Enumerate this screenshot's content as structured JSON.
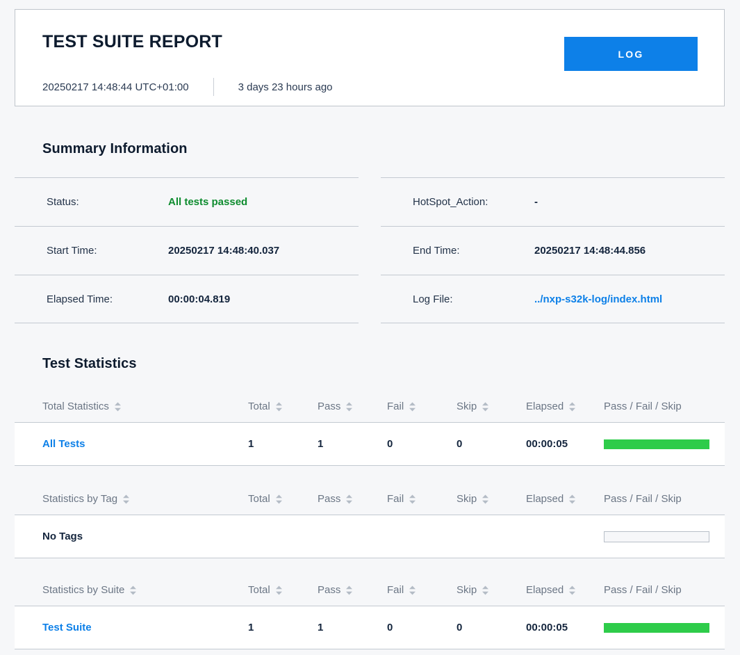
{
  "header": {
    "title": "TEST SUITE REPORT",
    "generated": "20250217 14:48:44 UTC+01:00",
    "relative_time": "3 days 23 hours ago",
    "log_button": "LOG",
    "accent_color": "#0d80e8"
  },
  "summary": {
    "title": "Summary Information",
    "left": [
      {
        "label": "Status:",
        "value": "All tests passed",
        "kind": "pass"
      },
      {
        "label": "Start Time:",
        "value": "20250217 14:48:40.037",
        "kind": "text"
      },
      {
        "label": "Elapsed Time:",
        "value": "00:00:04.819",
        "kind": "text"
      }
    ],
    "right": [
      {
        "label": "HotSpot_Action:",
        "value": "-",
        "kind": "dash"
      },
      {
        "label": "End Time:",
        "value": "20250217 14:48:44.856",
        "kind": "text"
      },
      {
        "label": "Log File:",
        "value": "../nxp-s32k-log/index.html",
        "kind": "link"
      }
    ]
  },
  "statistics": {
    "title": "Test Statistics",
    "columns": {
      "total": "Total",
      "pass": "Pass",
      "fail": "Fail",
      "skip": "Skip",
      "elapsed": "Elapsed",
      "graph": "Pass / Fail / Skip"
    },
    "tables": [
      {
        "header": "Total Statistics",
        "rows": [
          {
            "name": "All Tests",
            "name_is_link": true,
            "total": "1",
            "pass": "1",
            "fail": "0",
            "skip": "0",
            "elapsed": "00:00:05",
            "bar": {
              "pass_pct": 100,
              "fail_pct": 0,
              "skip_pct": 0,
              "empty": false
            }
          }
        ]
      },
      {
        "header": "Statistics by Tag",
        "rows": [
          {
            "name": "No Tags",
            "name_is_link": false,
            "total": "",
            "pass": "",
            "fail": "",
            "skip": "",
            "elapsed": "",
            "bar": {
              "pass_pct": 0,
              "fail_pct": 0,
              "skip_pct": 0,
              "empty": true
            }
          }
        ]
      },
      {
        "header": "Statistics by Suite",
        "rows": [
          {
            "name": "Test Suite",
            "name_is_link": true,
            "total": "1",
            "pass": "1",
            "fail": "0",
            "skip": "0",
            "elapsed": "00:00:05",
            "bar": {
              "pass_pct": 100,
              "fail_pct": 0,
              "skip_pct": 0,
              "empty": false
            }
          }
        ]
      }
    ]
  },
  "colors": {
    "pass_green": "#2ecc4a",
    "status_green": "#0e8c2f",
    "link_blue": "#0d80e8",
    "page_bg": "#f6f7f9"
  }
}
